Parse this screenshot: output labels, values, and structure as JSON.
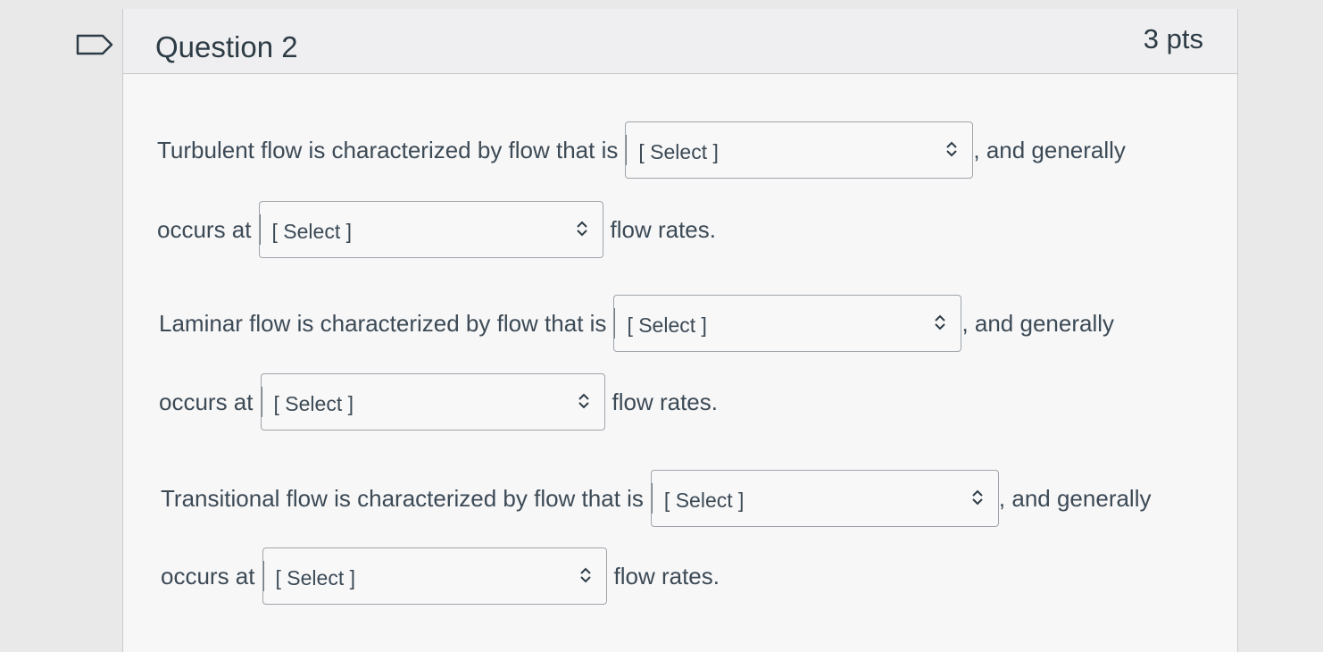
{
  "question": {
    "title": "Question 2",
    "points": "3 pts"
  },
  "paragraphs": [
    {
      "line1_text": "Turbulent flow is characterized by flow that is",
      "select1": "[ Select ]",
      "line1_suffix": ", and generally",
      "line2_text": "occurs at",
      "select2": "[ Select ]",
      "line2_suffix": "flow rates."
    },
    {
      "line1_text": "Laminar flow is characterized by flow that is",
      "select1": "[ Select ]",
      "line1_suffix": ", and generally",
      "line2_text": "occurs at",
      "select2": "[ Select ]",
      "line2_suffix": "flow rates."
    },
    {
      "line1_text": "Transitional flow is characterized by flow that is",
      "select1": "[ Select ]",
      "line1_suffix": ", and generally",
      "line2_text": "occurs at",
      "select2": "[ Select ]",
      "line2_suffix": "flow rates."
    }
  ],
  "icons": {
    "flag": "flag-icon",
    "dropdown": "chevron-up-down-icon"
  },
  "colors": {
    "text": "#2d3b45",
    "border": "#9ea4a9",
    "background": "#f7f7f8"
  }
}
